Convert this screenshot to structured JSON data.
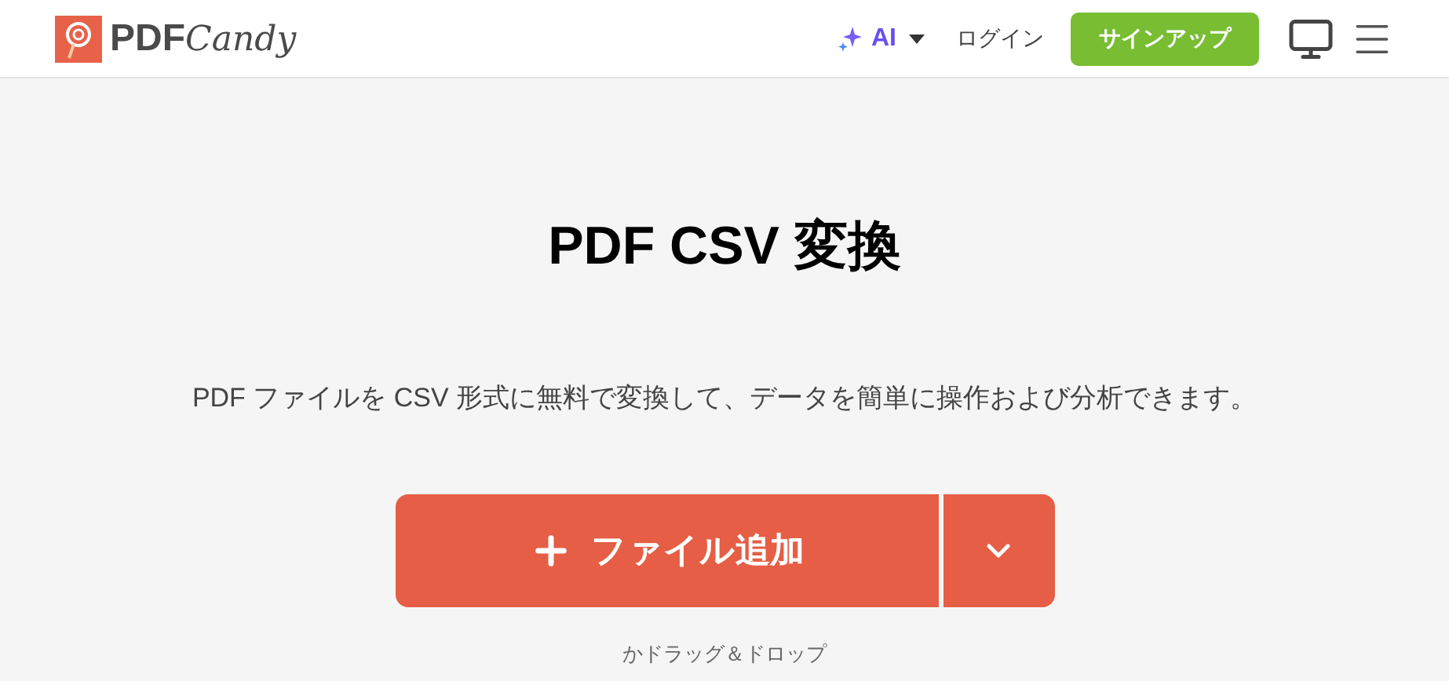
{
  "header": {
    "logo": {
      "bold": "PDF",
      "script": "Candy"
    },
    "ai_menu": {
      "label": "AI"
    },
    "login": "ログイン",
    "signup": "サインアップ"
  },
  "main": {
    "title": "PDF CSV 変換",
    "description": "PDF ファイルを CSV 形式に無料で変換して、データを簡単に操作および分析できます。",
    "add_button": "ファイル追加",
    "drop_hint": "かドラッグ＆ドロップ"
  }
}
